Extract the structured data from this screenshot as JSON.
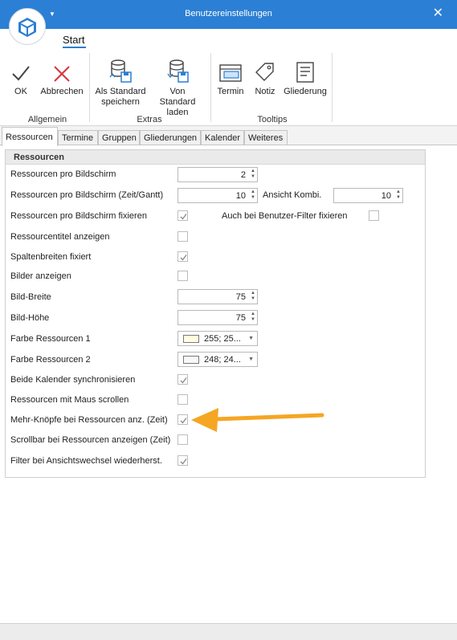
{
  "window": {
    "title": "Benutzereinstellungen"
  },
  "ribbon": {
    "tab_start": "Start",
    "groups": [
      {
        "label": "Allgemein",
        "buttons": [
          "OK",
          "Abbrechen"
        ]
      },
      {
        "label": "Extras",
        "buttons": [
          "Als Standard speichern",
          "Von Standard laden"
        ]
      },
      {
        "label": "Tooltips",
        "buttons": [
          "Termin",
          "Notiz",
          "Gliederung"
        ]
      }
    ]
  },
  "tabs": [
    "Ressourcen",
    "Termine",
    "Gruppen",
    "Gliederungen",
    "Kalender",
    "Weiteres"
  ],
  "panel": {
    "title": "Ressourcen",
    "rows": [
      {
        "label": "Ressourcen pro Bildschirm",
        "value": "2"
      },
      {
        "label": "Ressourcen pro Bildschirm (Zeit/Gantt)",
        "value": "10",
        "extra_label": "Ansicht Kombi.",
        "extra_value": "10"
      },
      {
        "label": "Ressourcen pro Bildschirm fixieren",
        "checked": true,
        "extra_label": "Auch bei Benutzer-Filter fixieren",
        "extra_checked": false
      },
      {
        "label": "Ressourcentitel anzeigen",
        "checked": false
      },
      {
        "label": "Spaltenbreiten fixiert",
        "checked": true
      },
      {
        "label": "Bilder anzeigen",
        "checked": false
      },
      {
        "label": "Bild-Breite",
        "value": "75"
      },
      {
        "label": "Bild-Höhe",
        "value": "75"
      },
      {
        "label": "Farbe Ressourcen 1",
        "color_text": "255; 25...",
        "swatch": "#fefde0"
      },
      {
        "label": "Farbe Ressourcen 2",
        "color_text": "248; 24...",
        "swatch": "#f8f8f8"
      },
      {
        "label": "Beide Kalender synchronisieren",
        "checked": true
      },
      {
        "label": "Ressourcen mit Maus scrollen",
        "checked": false
      },
      {
        "label": "Mehr-Knöpfe bei Ressourcen anz. (Zeit)",
        "checked": true
      },
      {
        "label": "Scrollbar bei Ressourcen anzeigen (Zeit)",
        "checked": false
      },
      {
        "label": "Filter bei Ansichtswechsel wiederherst.",
        "checked": true
      }
    ]
  },
  "colors": {
    "accent": "#2b7fd4",
    "arrow": "#f5a623",
    "cancel": "#d9343e"
  }
}
